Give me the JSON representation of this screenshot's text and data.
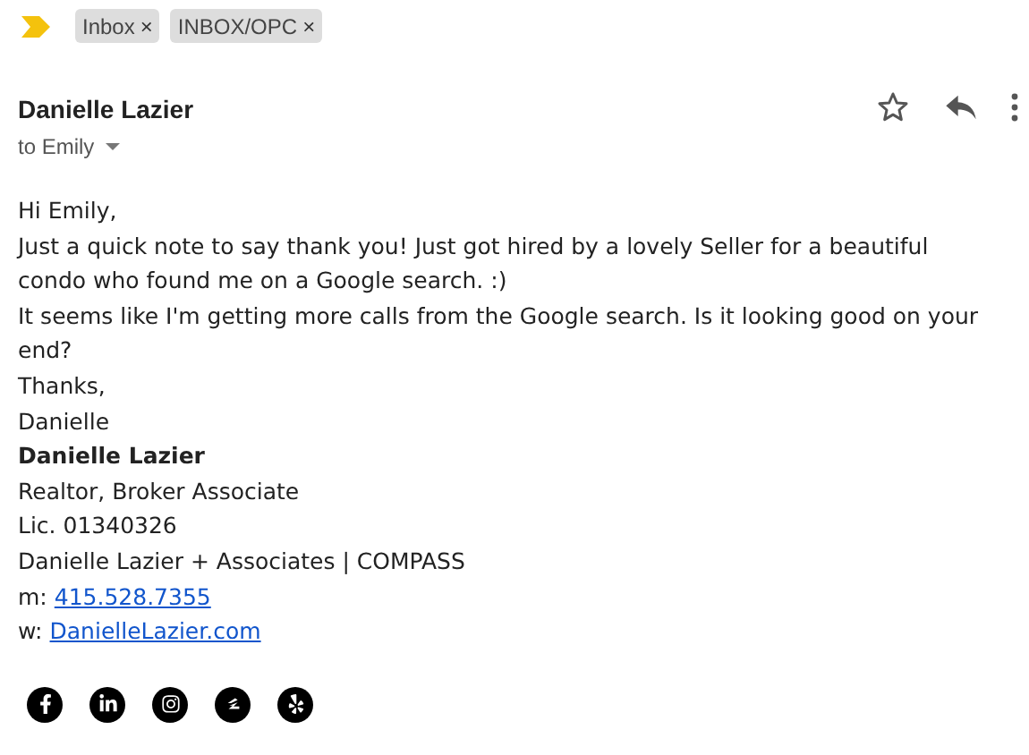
{
  "importance_marker": {
    "important": true
  },
  "labels": [
    {
      "name": "Inbox",
      "remove": "×"
    },
    {
      "name": "INBOX/OPC",
      "remove": "×"
    }
  ],
  "message": {
    "sender": "Danielle Lazier",
    "recipient": "to Emily",
    "starred": false,
    "body": [
      "Hi Emily,",
      "Just a quick note to say thank you! Just got hired by a lovely Seller for a beautiful condo who found me on a Google search. :)",
      "It seems like I'm getting more calls from the Google search. Is it looking good on your end?",
      "Thanks,",
      "Danielle"
    ],
    "signature": [
      {
        "kind": "bold",
        "text": "Danielle Lazier"
      },
      {
        "kind": "text",
        "text": "Realtor, Broker Associate"
      },
      {
        "kind": "text",
        "text": "Lic. 01340326"
      },
      {
        "kind": "text",
        "text": "Danielle Lazier + Associates | COMPASS"
      },
      {
        "kind": "link",
        "prefix": "m:",
        "text": "415.528.7355"
      },
      {
        "kind": "link",
        "prefix": "w:",
        "text": "DanielleLazier.com"
      }
    ],
    "social": [
      {
        "kind": "facebook"
      },
      {
        "kind": "linkedin"
      },
      {
        "kind": "instagram"
      },
      {
        "kind": "zillow"
      },
      {
        "kind": "yelp"
      }
    ]
  }
}
